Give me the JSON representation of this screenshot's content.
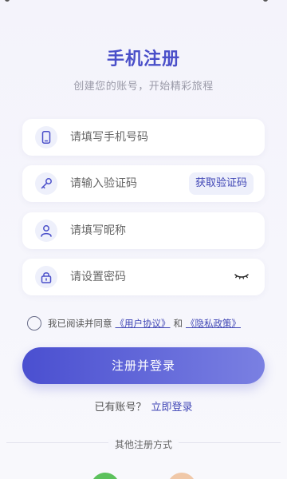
{
  "header": {
    "title": "手机注册",
    "subtitle": "创建您的账号，开始精彩旅程"
  },
  "form": {
    "phone": {
      "placeholder": "请填写手机号码",
      "icon": "phone-icon"
    },
    "code": {
      "placeholder": "请输入验证码",
      "icon": "key-icon",
      "get_code_label": "获取验证码"
    },
    "nickname": {
      "placeholder": "请填写昵称",
      "icon": "user-icon"
    },
    "password": {
      "placeholder": "请设置密码",
      "icon": "lock-icon",
      "toggle_icon": "eye-closed-icon"
    }
  },
  "agreement": {
    "prefix": "我已阅读并同意",
    "user_agreement": "《用户协议》",
    "and": "和",
    "privacy_policy": "《隐私政策》"
  },
  "actions": {
    "submit_label": "注册并登录",
    "have_account": "已有账号？",
    "login_link": "立即登录"
  },
  "other": {
    "label": "其他注册方式",
    "social": [
      {
        "icon": "wechat-icon",
        "color": "#5cc15c"
      },
      {
        "icon": "qq-icon",
        "color": "#f0c8a8"
      }
    ]
  },
  "colors": {
    "accent": "#4a4fc9",
    "link": "#3f45b5",
    "button_start": "#4a4fd0",
    "button_end": "#7a80e2"
  }
}
